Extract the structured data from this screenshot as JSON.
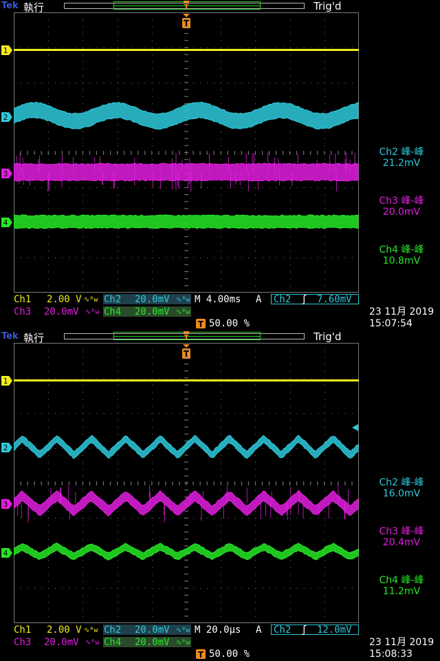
{
  "colors": {
    "ch1": "#f2ec1e",
    "ch2": "#2ecadc",
    "ch3": "#e21ee0",
    "ch4": "#26e826",
    "orange": "#f08a1e",
    "grid": "#7a7a7a"
  },
  "panels": [
    {
      "header": {
        "brand": "Tek",
        "run_state": "執行",
        "trigger_status": "Trig'd"
      },
      "channel_markers": [
        "1",
        "2",
        "3",
        "4"
      ],
      "measurements": [
        {
          "label": "Ch2 峰-峰",
          "value": "21.2mV"
        },
        {
          "label": "Ch3 峰-峰",
          "value": "20.0mV"
        },
        {
          "label": "Ch4 峰-峰",
          "value": "10.8mV"
        }
      ],
      "status": {
        "ch1_label": "Ch1",
        "ch1_scale": "2.00 V",
        "ch2_label": "Ch2",
        "ch2_scale": "20.0mV",
        "ch3_label": "Ch3",
        "ch3_scale": "20.0mV",
        "ch4_label": "Ch4",
        "ch4_scale": "20.0mV",
        "bw_mark": "∿ᴮw",
        "timebase": "M 4.00ms",
        "trigger_mode": "A",
        "trigger_source": "Ch2",
        "trigger_slope": "ʃ",
        "trigger_level": "7.60mV",
        "trigger_position": "50.00 %",
        "date": "23 11月 2019",
        "time": "15:07:54"
      },
      "waveforms": {
        "ch2": {
          "shape": "sine",
          "cycles": 4.2,
          "pp_mV": 21.2
        },
        "ch3": {
          "shape": "noise",
          "pp_mV": 20.0
        },
        "ch4": {
          "shape": "noise",
          "pp_mV": 10.8
        }
      }
    },
    {
      "header": {
        "brand": "Tek",
        "run_state": "執行",
        "trigger_status": "Trig'd"
      },
      "channel_markers": [
        "1",
        "2",
        "3",
        "4"
      ],
      "measurements": [
        {
          "label": "Ch2 峰-峰",
          "value": "16.0mV"
        },
        {
          "label": "Ch3 峰-峰",
          "value": "20.4mV"
        },
        {
          "label": "Ch4 峰-峰",
          "value": "11.2mV"
        }
      ],
      "status": {
        "ch1_label": "Ch1",
        "ch1_scale": "2.00 V",
        "ch2_label": "Ch2",
        "ch2_scale": "20.0mV",
        "ch3_label": "Ch3",
        "ch3_scale": "20.0mV",
        "ch4_label": "Ch4",
        "ch4_scale": "20.0mV",
        "bw_mark": "∿ᴮw",
        "timebase": "M 20.0µs",
        "trigger_mode": "A",
        "trigger_source": "Ch2",
        "trigger_slope": "ʃ",
        "trigger_level": "12.0mV",
        "trigger_position": "50.00 %",
        "date": "23 11月 2019",
        "time": "15:08:33"
      },
      "waveforms": {
        "ch2": {
          "shape": "triangle",
          "cycles": 10,
          "pp_mV": 16.0
        },
        "ch3": {
          "shape": "triangle",
          "cycles": 10,
          "pp_mV": 20.4
        },
        "ch4": {
          "shape": "triangle",
          "cycles": 10,
          "pp_mV": 11.2
        }
      }
    }
  ]
}
